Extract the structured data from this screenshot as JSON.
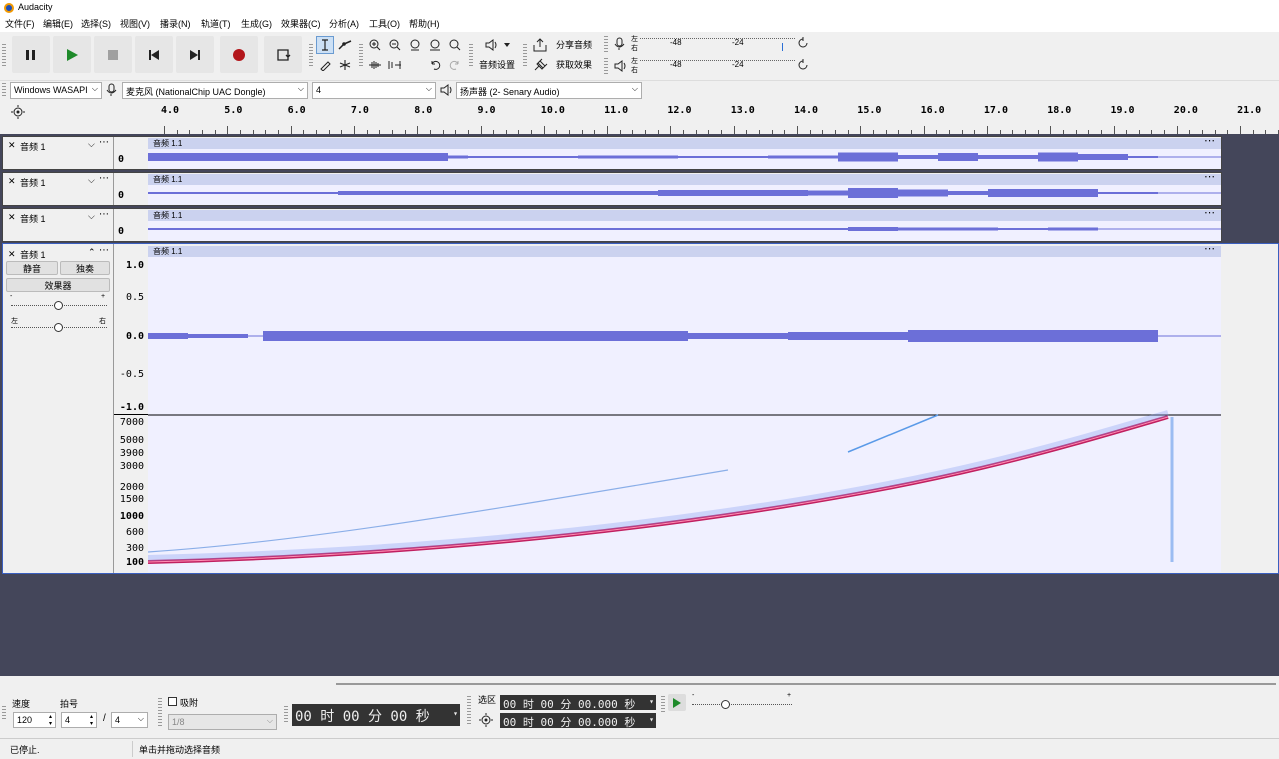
{
  "app": {
    "title": "Audacity"
  },
  "menu": [
    "文件(F)",
    "编辑(E)",
    "选择(S)",
    "视图(V)",
    "播录(N)",
    "轨道(T)",
    "生成(G)",
    "效果器(C)",
    "分析(A)",
    "工具(O)",
    "帮助(H)"
  ],
  "toolbar": {
    "share_label": "分享音频",
    "get_effects_label": "获取效果",
    "audio_settings_label": "音频设置",
    "meter_rec_top": "左",
    "meter_rec_bottom": "右",
    "meter_play_top": "左",
    "meter_play_bottom": "右",
    "meter_tick_a": "-48",
    "meter_tick_b": "-24"
  },
  "device": {
    "host": "Windows WASAPI",
    "mic": "麦克风 (NationalChip UAC Dongle)",
    "channels": "4",
    "speaker": "扬声器 (2- Senary Audio)"
  },
  "ruler": [
    "4.0",
    "5.0",
    "6.0",
    "7.0",
    "8.0",
    "9.0",
    "10.0",
    "11.0",
    "12.0",
    "13.0",
    "14.0",
    "15.0",
    "16.0",
    "17.0",
    "18.0",
    "19.0",
    "20.0",
    "21.0"
  ],
  "tracks": [
    {
      "name": "音频 1",
      "clip": "音频 1.1",
      "scale": "0"
    },
    {
      "name": "音频 1",
      "clip": "音频 1.1",
      "scale": "0"
    },
    {
      "name": "音频 1",
      "clip": "音频 1.1",
      "scale": "0"
    },
    {
      "name": "音频 1",
      "clip": "音频 1.1",
      "mute": "静音",
      "solo": "独奏",
      "effects": "效果器",
      "gain_minus": "-",
      "gain_plus": "+",
      "pan_left": "左",
      "pan_right": "右",
      "wave_scale": [
        "1.0",
        "0.5",
        "0.0",
        "-0.5",
        "-1.0"
      ],
      "spec_scale": [
        "7000",
        "5000",
        "3900",
        "3000",
        "2000",
        "1500",
        "1000",
        "600",
        "300",
        "100"
      ]
    }
  ],
  "bottom": {
    "tempo_label": "速度",
    "tempo": "120",
    "sig_label": "拍号",
    "sig_num": "4",
    "sig_slash": "/",
    "sig_den": "4",
    "snap_label": "吸附",
    "snap_value": "1/8",
    "time": "00 时 00 分 00 秒",
    "selection_label": "选区",
    "sel_start": "00 时 00 分 00.000 秒",
    "sel_end": "00 时 00 分 00.000 秒",
    "speed_minus": "-",
    "speed_plus": "+"
  },
  "status": {
    "left": "已停止.",
    "right": "单击并拖动选择音频"
  },
  "colors": {
    "wave": "#6c6fd8",
    "spectro_line": "#d4145a",
    "track_bg": "#f0f0ff",
    "dark": "#44465a"
  }
}
